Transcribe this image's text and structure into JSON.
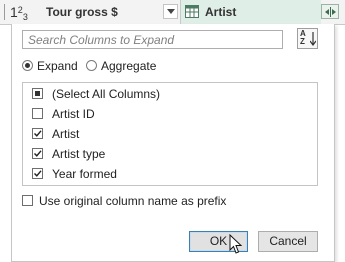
{
  "header": {
    "left_column": {
      "type_icon": "number-type-icon",
      "type_text": {
        "one": "1",
        "two": "2",
        "three": "3"
      },
      "title": "Tour gross $",
      "dropdown_icon": "chevron-down-icon"
    },
    "right_column": {
      "type_icon": "table-icon",
      "title": "Artist",
      "dropdown_icon": "chevron-down-icon",
      "expand_icon": "expand-columns-icon",
      "bg_color": "#dfeee6"
    }
  },
  "panel": {
    "search": {
      "placeholder": "Search Columns to Expand",
      "value": ""
    },
    "sort_button": {
      "icon": "sort-az-icon",
      "top_letter": "A",
      "bottom_letter": "Z"
    },
    "mode": {
      "options": [
        {
          "label": "Expand",
          "selected": true
        },
        {
          "label": "Aggregate",
          "selected": false
        }
      ]
    },
    "columns": [
      {
        "label": "(Select All Columns)",
        "state": "partial"
      },
      {
        "label": "Artist ID",
        "state": "unchecked"
      },
      {
        "label": "Artist",
        "state": "checked"
      },
      {
        "label": "Artist type",
        "state": "checked"
      },
      {
        "label": "Year formed",
        "state": "checked"
      }
    ],
    "prefix_option": {
      "label": "Use original column name as prefix",
      "checked": false
    },
    "ok_label": "OK",
    "cancel_label": "Cancel"
  },
  "cursor_icon": "mouse-pointer-icon"
}
